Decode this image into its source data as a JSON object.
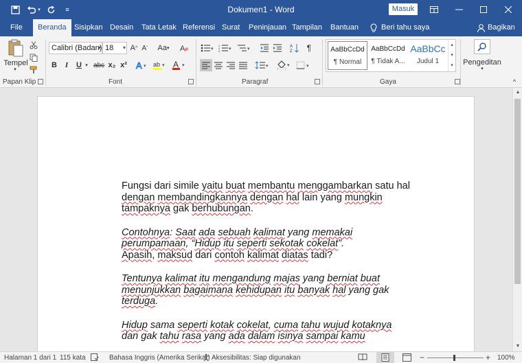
{
  "titlebar": {
    "title": "Dokumen1  -  Word",
    "masuk_label": "Masuk",
    "save_icon": "save-icon",
    "undo_icon": "undo-icon",
    "redo_icon": "redo-icon",
    "customize_icon": "customize-qat-icon"
  },
  "tabs": [
    "File",
    "Beranda",
    "Sisipkan",
    "Desain",
    "Tata Letak",
    "Referensi",
    "Surat",
    "Peninjauan",
    "Tampilan",
    "Bantuan"
  ],
  "tellme": "Beri tahu saya",
  "share": "Bagikan",
  "ribbon": {
    "clipboard": {
      "paste_label": "Tempel",
      "group_label": "Papan Klip"
    },
    "font": {
      "font_name": "Calibri (Badan)",
      "font_size": "18",
      "change_case": "Aa",
      "bold": "B",
      "italic": "I",
      "underline": "U",
      "strike": "abc",
      "subscript": "x₂",
      "superscript": "x²",
      "group_label": "Font"
    },
    "paragraph": {
      "group_label": "Paragraf"
    },
    "styles": {
      "items": [
        {
          "sample": "AaBbCcDd",
          "name": "¶ Normal"
        },
        {
          "sample": "AaBbCcDd",
          "name": "¶ Tidak A..."
        },
        {
          "sample": "AaBbCc",
          "name": "Judul 1"
        }
      ],
      "group_label": "Gaya"
    },
    "editing": {
      "label": "Pengeditan"
    }
  },
  "document": {
    "paragraphs": [
      {
        "italic": false,
        "lines": [
          [
            [
              "Fungsi dari simile ",
              false
            ],
            [
              "yaitu",
              true
            ],
            [
              " ",
              false
            ],
            [
              "buat",
              true
            ],
            [
              " ",
              false
            ],
            [
              "membantu",
              true
            ],
            [
              " ",
              false
            ],
            [
              "menggambarkan",
              true
            ],
            [
              " satu hal",
              false
            ]
          ],
          [
            [
              "dengan",
              true
            ],
            [
              " ",
              false
            ],
            [
              "membandingkannya",
              true
            ],
            [
              " ",
              false
            ],
            [
              "dengan",
              true
            ],
            [
              " ",
              false
            ],
            [
              "hal",
              true
            ],
            [
              " lain yang ",
              false
            ],
            [
              "mungkin",
              true
            ]
          ],
          [
            [
              "tampaknya",
              true
            ],
            [
              " gak ",
              false
            ],
            [
              "berhubungan",
              true
            ],
            [
              ".",
              false
            ]
          ]
        ]
      },
      {
        "italic": true,
        "lines": [
          [
            [
              "Contohnya",
              true
            ],
            [
              ": ",
              false
            ],
            [
              "Saat",
              true
            ],
            [
              " ",
              false
            ],
            [
              "ada",
              true
            ],
            [
              " ",
              false
            ],
            [
              "sebuah",
              true
            ],
            [
              " ",
              false
            ],
            [
              "kalimat",
              true
            ],
            [
              " yang ",
              false
            ],
            [
              "memakai",
              true
            ]
          ],
          [
            [
              "perumpamaan",
              true
            ],
            [
              ", “",
              false
            ],
            [
              "Hidup",
              true
            ],
            [
              " ",
              false
            ],
            [
              "itu",
              true
            ],
            [
              " ",
              false
            ],
            [
              "seperti",
              true
            ],
            [
              " ",
              false
            ],
            [
              "sekotak",
              true
            ],
            [
              " ",
              false
            ],
            [
              "cokelat",
              true
            ],
            [
              "”.",
              false
            ]
          ],
          [
            [
              "Apasih",
              true
            ],
            [
              ", ",
              false
            ],
            [
              "maksud",
              true
            ],
            [
              " dari ",
              false
            ],
            [
              "contoh",
              true
            ],
            [
              " ",
              false
            ],
            [
              "kalimat",
              true
            ],
            [
              " ",
              false
            ],
            [
              "diatas",
              true
            ],
            [
              " tadi?",
              false
            ]
          ]
        ],
        "last_line_upright": true
      },
      {
        "italic": true,
        "lines": [
          [
            [
              "Tentunya",
              true
            ],
            [
              " ",
              false
            ],
            [
              "kalimat",
              true
            ],
            [
              " ",
              false
            ],
            [
              "itu",
              true
            ],
            [
              " ",
              false
            ],
            [
              "mengandung",
              true
            ],
            [
              " ",
              false
            ],
            [
              "majas",
              true
            ],
            [
              " yang ",
              false
            ],
            [
              "berniat",
              true
            ],
            [
              " ",
              false
            ],
            [
              "buat",
              true
            ]
          ],
          [
            [
              "menunjukkan",
              true
            ],
            [
              " ",
              false
            ],
            [
              "bagaimana",
              true
            ],
            [
              " ",
              false
            ],
            [
              "kehidupan",
              true
            ],
            [
              " ",
              false
            ],
            [
              "itu",
              true
            ],
            [
              " ",
              false
            ],
            [
              "banyak",
              true
            ],
            [
              " ",
              false
            ],
            [
              "hal",
              true
            ],
            [
              " yang gak",
              false
            ]
          ],
          [
            [
              "terduga",
              true
            ],
            [
              ".",
              false
            ]
          ]
        ]
      },
      {
        "italic": true,
        "lines": [
          [
            [
              "Hidup",
              true
            ],
            [
              " sama ",
              false
            ],
            [
              "seperti",
              true
            ],
            [
              " ",
              false
            ],
            [
              "kotak",
              true
            ],
            [
              " ",
              false
            ],
            [
              "cokelat",
              true
            ],
            [
              ", ",
              false
            ],
            [
              "cuma",
              true
            ],
            [
              " ",
              false
            ],
            [
              "tahu",
              true
            ],
            [
              " ",
              false
            ],
            [
              "wujud",
              true
            ],
            [
              " ",
              false
            ],
            [
              "kotaknya",
              true
            ]
          ],
          [
            [
              "dan gak ",
              false
            ],
            [
              "tahu",
              true
            ],
            [
              " ",
              false
            ],
            [
              "rasa",
              true
            ],
            [
              " yang ",
              false
            ],
            [
              "ada",
              true
            ],
            [
              " ",
              false
            ],
            [
              "dalam",
              true
            ],
            [
              " ",
              false
            ],
            [
              "isinya",
              true
            ],
            [
              " ",
              false
            ],
            [
              "sampai",
              true
            ],
            [
              " ",
              false
            ],
            [
              "kamu",
              true
            ]
          ]
        ]
      }
    ]
  },
  "statusbar": {
    "page": "Halaman 1 dari 1",
    "words": "115 kata",
    "language": "Bahasa Inggris (Amerika Serikat)",
    "accessibility": "Aksesibilitas: Siap digunakan",
    "zoom": "100%",
    "zoom_level": 1.0
  },
  "colors": {
    "brand": "#2b579a",
    "highlight": "#ffff00",
    "font_color": "#e0201b"
  }
}
